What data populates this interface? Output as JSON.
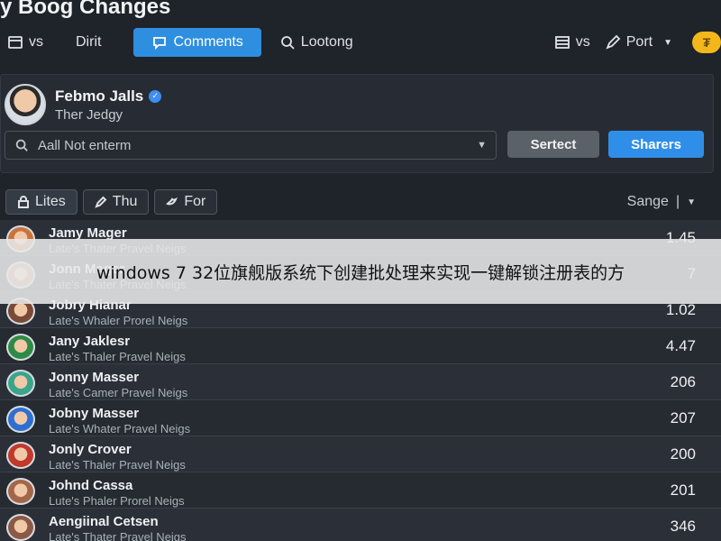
{
  "window": {
    "title": "y Boog Changes"
  },
  "nav": {
    "items": [
      {
        "label": "vs",
        "icon": "calendar-icon"
      },
      {
        "label": "Dirit",
        "icon": "none"
      },
      {
        "label": "Comments",
        "icon": "comment-icon",
        "active": true
      },
      {
        "label": "Lootong",
        "icon": "search-icon"
      }
    ],
    "right": [
      {
        "label": "vs",
        "icon": "list-icon"
      },
      {
        "label": "Port",
        "icon": "pencil-icon"
      }
    ],
    "coin": {
      "label": "₮",
      "color": "#f2b81b"
    }
  },
  "profile": {
    "name": "Febmo Jalls",
    "subtitle": "Ther Jedgy",
    "verified": true
  },
  "search": {
    "placeholder": "Aall Not enterm"
  },
  "actions": {
    "select_label": "Sertect",
    "share_label": "Sharers"
  },
  "filters": {
    "chips": [
      {
        "label": "Lites",
        "icon": "lock-icon"
      },
      {
        "label": "Thu",
        "icon": "pencil-icon"
      },
      {
        "label": "For",
        "icon": "bird-icon"
      }
    ],
    "sort_label": "Sange"
  },
  "rows": [
    {
      "name": "Jamy Mager",
      "sub": "Late's Thater Pravel Neigs",
      "value": "1.45",
      "avatar_color": "#c9743c"
    },
    {
      "name": "Jonn Mager",
      "sub": "Late's Thater Pravel Neigs",
      "value": "7",
      "avatar_color": "#b8866a"
    },
    {
      "name": "Jobry Hianar",
      "sub": "Late's Whaler Prorel Neigs",
      "value": "1.02",
      "avatar_color": "#7a4a35"
    },
    {
      "name": "Jany Jaklesr",
      "sub": "Late's Thaler Pravel Neigs",
      "value": "4.47",
      "avatar_color": "#2e8b45"
    },
    {
      "name": "Jonny Masser",
      "sub": "Late's Camer Pravel Neigs",
      "value": "206",
      "avatar_color": "#3aa58b"
    },
    {
      "name": "Jobny Masser",
      "sub": "Late's Whater Pravel Neigs",
      "value": "207",
      "avatar_color": "#2f6fd1"
    },
    {
      "name": "Jonly Crover",
      "sub": "Late's Thaler Pravel Neigs",
      "value": "200",
      "avatar_color": "#c0392b"
    },
    {
      "name": "Johnd Cassa",
      "sub": "Lute's Phaler Prorel Neigs",
      "value": "201",
      "avatar_color": "#a4664a"
    },
    {
      "name": "Aengiinal Cetsen",
      "sub": "Late's Thater Pravel Neigs",
      "value": "346",
      "avatar_color": "#8a5a44"
    }
  ],
  "banner": {
    "text": "windows 7 32位旗舰版系统下创建批处理来实现一键解锁注册表的方"
  }
}
